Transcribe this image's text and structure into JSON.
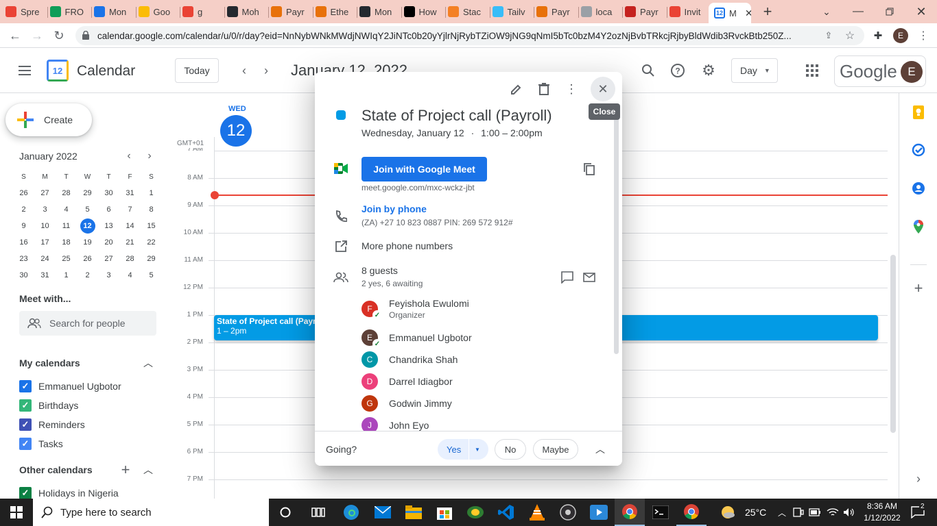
{
  "browser": {
    "tabs": [
      {
        "title": "Spre",
        "color": "#ea4335"
      },
      {
        "title": "FRO",
        "color": "#0f9d58"
      },
      {
        "title": "Mon",
        "color": "#1a73e8"
      },
      {
        "title": "Goo",
        "color": "#fbbc04"
      },
      {
        "title": "g",
        "color": "#ea4335"
      },
      {
        "title": "Moh",
        "color": "#24292f"
      },
      {
        "title": "Payr",
        "color": "#e8710a"
      },
      {
        "title": "Ethe",
        "color": "#e8710a"
      },
      {
        "title": "Mon",
        "color": "#24292f"
      },
      {
        "title": "How",
        "color": "#000000"
      },
      {
        "title": "Stac",
        "color": "#f48024"
      },
      {
        "title": "Tailv",
        "color": "#38bdf8"
      },
      {
        "title": "Payr",
        "color": "#e8710a"
      },
      {
        "title": "loca",
        "color": "#9aa0a6"
      },
      {
        "title": "Payr",
        "color": "#c5221f"
      },
      {
        "title": "Invit",
        "color": "#ea4335"
      }
    ],
    "active_tab": "M",
    "url": "calendar.google.com/calendar/u/0/r/day?eid=NnNybWNkMWdjNWIqY2JiNTc0b20yYjlrNjRybTZiOW9jNG9qNmI5bTc0bzM4Y2ozNjBvbTRkcjRjbyBldWdib3RvckBtb250Z..."
  },
  "header": {
    "app_name": "Calendar",
    "logo_day": "12",
    "today_label": "Today",
    "date_title": "January 12, 2022",
    "view_label": "Day",
    "google_label": "Google",
    "avatar_letter": "E"
  },
  "sidebar": {
    "create_label": "Create",
    "month_title": "January 2022",
    "weekday_headers": [
      "S",
      "M",
      "T",
      "W",
      "T",
      "F",
      "S"
    ],
    "weeks": [
      [
        "26",
        "27",
        "28",
        "29",
        "30",
        "31",
        "1"
      ],
      [
        "2",
        "3",
        "4",
        "5",
        "6",
        "7",
        "8"
      ],
      [
        "9",
        "10",
        "11",
        "12",
        "13",
        "14",
        "15"
      ],
      [
        "16",
        "17",
        "18",
        "19",
        "20",
        "21",
        "22"
      ],
      [
        "23",
        "24",
        "25",
        "26",
        "27",
        "28",
        "29"
      ],
      [
        "30",
        "31",
        "1",
        "2",
        "3",
        "4",
        "5"
      ]
    ],
    "selected_day": "12",
    "meet_with": "Meet with...",
    "search_people_placeholder": "Search for people",
    "my_calendars_title": "My calendars",
    "my_calendars": [
      {
        "name": "Emmanuel Ugbotor",
        "color": "#1a73e8"
      },
      {
        "name": "Birthdays",
        "color": "#33b679"
      },
      {
        "name": "Reminders",
        "color": "#3f51b5"
      },
      {
        "name": "Tasks",
        "color": "#4285f4"
      }
    ],
    "other_calendars_title": "Other calendars",
    "other_calendars": [
      {
        "name": "Holidays in Nigeria",
        "color": "#0b8043"
      }
    ]
  },
  "grid": {
    "day_name": "WED",
    "day_number": "12",
    "timezone": "GMT+01",
    "hours": [
      "7 AM",
      "8 AM",
      "9 AM",
      "10 AM",
      "11 AM",
      "12 PM",
      "1 PM",
      "2 PM",
      "3 PM",
      "4 PM",
      "5 PM",
      "6 PM",
      "7 PM"
    ],
    "event_title": "State of Project call (Payroll)",
    "event_time": "1 – 2pm",
    "event_color": "#039be5"
  },
  "popup": {
    "tooltip_close": "Close",
    "title": "State of Project call (Payroll)",
    "event_color": "#039be5",
    "when": "Wednesday, January 12",
    "dot": "·",
    "time_range": "1:00 – 2:00pm",
    "join_meet_label": "Join with Google Meet",
    "meet_link": "meet.google.com/mxc-wckz-jbt",
    "join_phone_label": "Join by phone",
    "phone_details": "(ZA) +27 10 823 0887 PIN: 269 572 912#",
    "more_phone_numbers": "More phone numbers",
    "guests_count": "8 guests",
    "guests_summary": "2 yes, 6 awaiting",
    "guests": [
      {
        "initial": "F",
        "name": "Feyishola Ewulomi",
        "role": "Organizer",
        "color": "#d93025",
        "accepted": true
      },
      {
        "initial": "E",
        "name": "Emmanuel Ugbotor",
        "role": "",
        "color": "#5d4037",
        "accepted": true
      },
      {
        "initial": "C",
        "name": "Chandrika Shah",
        "role": "",
        "color": "#0097a7",
        "accepted": false
      },
      {
        "initial": "D",
        "name": "Darrel Idiagbor",
        "role": "",
        "color": "#ec407a",
        "accepted": false
      },
      {
        "initial": "G",
        "name": "Godwin Jimmy",
        "role": "",
        "color": "#bf360c",
        "accepted": false
      },
      {
        "initial": "J",
        "name": "John Eyo",
        "role": "",
        "color": "#ab47bc",
        "accepted": false
      }
    ],
    "going_label": "Going?",
    "rsvp_yes": "Yes",
    "rsvp_no": "No",
    "rsvp_maybe": "Maybe"
  },
  "taskbar": {
    "search_placeholder": "Type here to search",
    "temperature": "25°C",
    "time": "8:36 AM",
    "date": "1/12/2022",
    "notification_count": "2"
  }
}
